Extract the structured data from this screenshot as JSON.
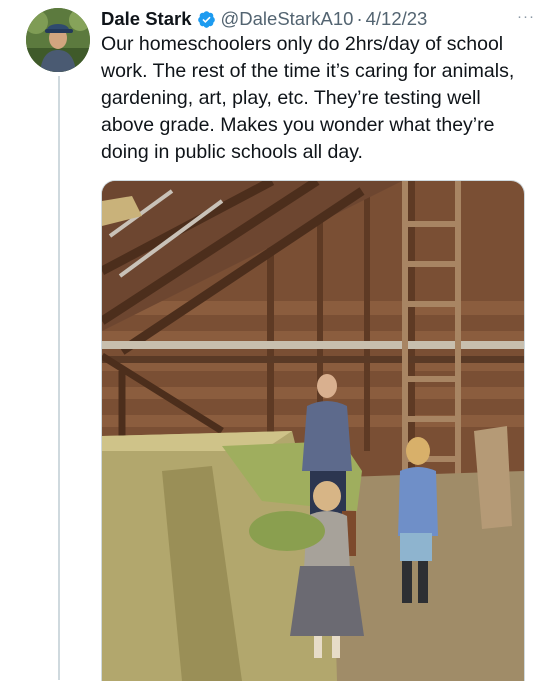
{
  "tweet": {
    "author_name": "Dale Stark",
    "handle": "@DaleStarkA10",
    "separator": "·",
    "date": "4/12/23",
    "text": "Our homeschoolers only do 2hrs/day of school work. The rest of the time it’s caring for animals, gardening, art, play, etc. They’re testing well above grade. Makes you wonder what they’re doing in public schools all day.",
    "more_label": "···"
  },
  "colors": {
    "verified_badge": "#1d9bf0",
    "secondary_text": "#536471",
    "primary_text": "#0f1419"
  },
  "icons": {
    "verified": "verified-badge-icon",
    "more": "more-icon"
  }
}
